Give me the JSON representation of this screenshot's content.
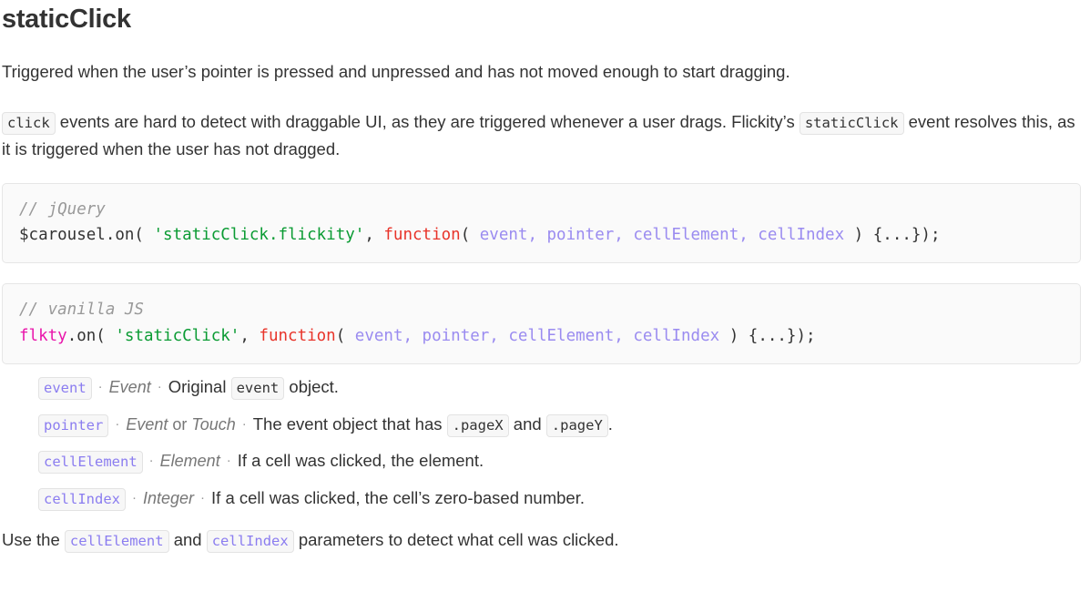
{
  "page": {
    "title": "staticClick",
    "intro": "Triggered when the user’s pointer is pressed and unpressed and has not moved enough to start dragging.",
    "second_paragraph": {
      "code_1": "click",
      "text_1": " events are hard to detect with draggable UI, as they are triggered whenever a user drags. Flickity’s ",
      "code_2": "staticClick",
      "text_2": " event resolves this, as it is triggered when the user has not dragged."
    },
    "closing_paragraph": {
      "text_1": "Use the ",
      "code_1": "cellElement",
      "text_2": " and ",
      "code_2": "cellIndex",
      "text_3": " parameters to detect what cell was clicked."
    }
  },
  "code_blocks": [
    {
      "id": "jquery-example",
      "comment": "// jQuery",
      "tokens": [
        {
          "text": "$carousel.on( ",
          "type": "plain"
        },
        {
          "text": "'staticClick.flickity'",
          "type": "string"
        },
        {
          "text": ", ",
          "type": "plain"
        },
        {
          "text": "function",
          "type": "keyword"
        },
        {
          "text": "( ",
          "type": "plain"
        },
        {
          "text": "event, pointer, cellElement, cellIndex",
          "type": "param"
        },
        {
          "text": " ) {...});",
          "type": "plain"
        }
      ]
    },
    {
      "id": "vanilla-js-example",
      "comment": "// vanilla JS",
      "tokens": [
        {
          "text": "flkty",
          "type": "var"
        },
        {
          "text": ".on( ",
          "type": "plain"
        },
        {
          "text": "'staticClick'",
          "type": "string"
        },
        {
          "text": ", ",
          "type": "plain"
        },
        {
          "text": "function",
          "type": "keyword"
        },
        {
          "text": "( ",
          "type": "plain"
        },
        {
          "text": "event, pointer, cellElement, cellIndex",
          "type": "param"
        },
        {
          "text": " ) {...});",
          "type": "plain"
        }
      ]
    }
  ],
  "parameters": [
    {
      "name": "event",
      "type": "Event",
      "type_join": "",
      "type_2": "",
      "desc_before": "Original ",
      "desc_code": "event",
      "desc_after": " object.",
      "desc_code_2": "",
      "desc_mid": "",
      "desc_end": ""
    },
    {
      "name": "pointer",
      "type": "Event",
      "type_join": " or ",
      "type_2": "Touch",
      "desc_before": "The event object that has ",
      "desc_code": ".pageX",
      "desc_after": " and ",
      "desc_code_2": ".pageY",
      "desc_mid": "",
      "desc_end": "."
    },
    {
      "name": "cellElement",
      "type": "Element",
      "type_join": "",
      "type_2": "",
      "desc_before": "If a cell was clicked, the element.",
      "desc_code": "",
      "desc_after": "",
      "desc_code_2": "",
      "desc_mid": "",
      "desc_end": ""
    },
    {
      "name": "cellIndex",
      "type": "Integer",
      "type_join": "",
      "type_2": "",
      "desc_before": "If a cell was clicked, the cell’s zero-based number.",
      "desc_code": "",
      "desc_after": "",
      "desc_code_2": "",
      "desc_mid": "",
      "desc_end": ""
    }
  ],
  "separator": "·",
  "colors": {
    "text": "#333333",
    "muted": "#777777",
    "comment": "#999999",
    "string": "#0a9b33",
    "keyword": "#e8342a",
    "param": "#9a8bf0",
    "variable": "#e916ab",
    "chip_bg": "#f7f7f7",
    "chip_border": "#e3e3e3",
    "codeblock_bg": "#fafafa"
  }
}
